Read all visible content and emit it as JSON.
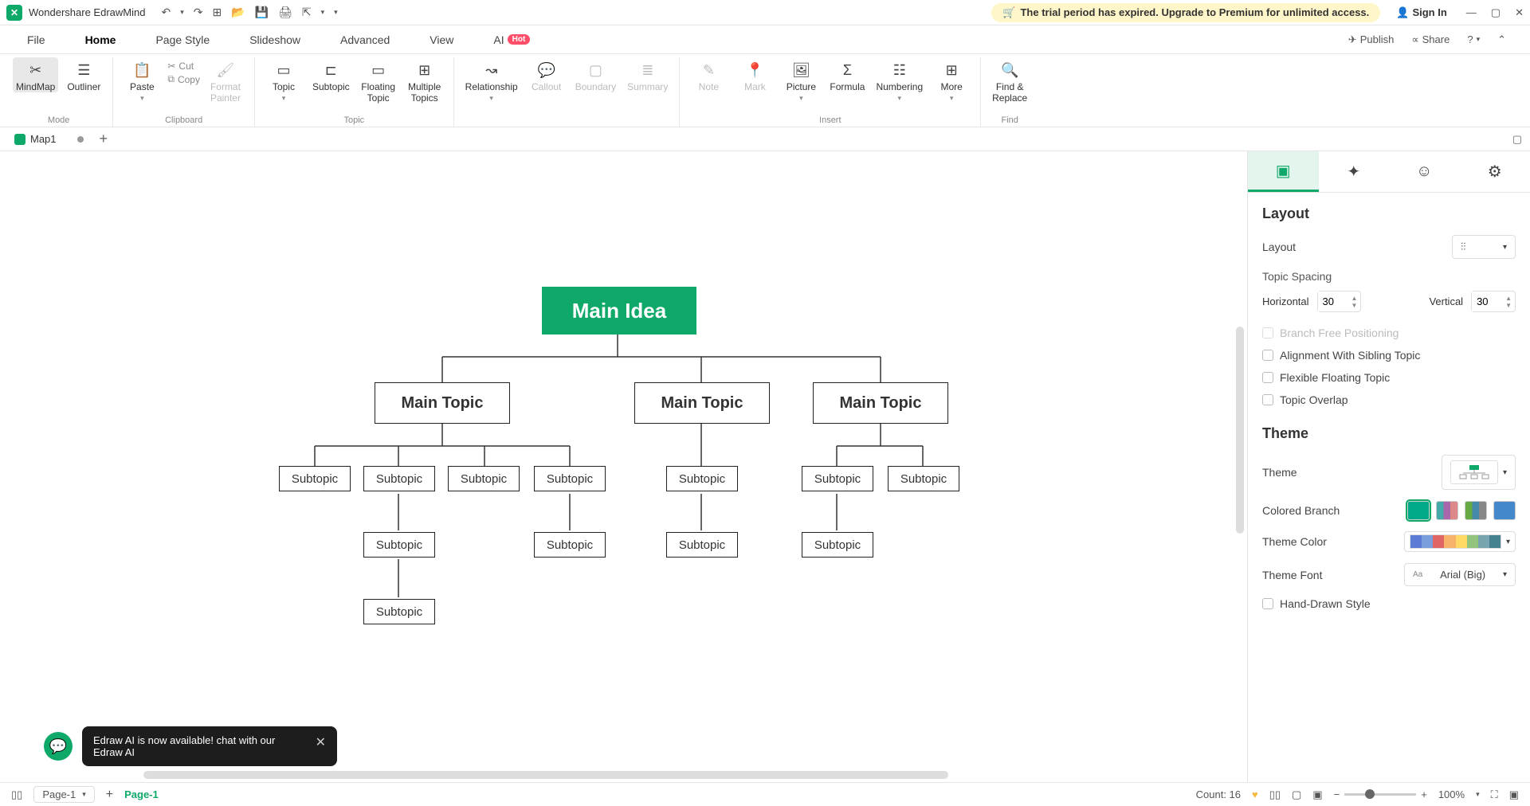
{
  "app": {
    "title": "Wondershare EdrawMind"
  },
  "trial": {
    "text": "The trial period has expired. Upgrade to Premium for unlimited access."
  },
  "signin": "Sign In",
  "menu": {
    "tabs": [
      "File",
      "Home",
      "Page Style",
      "Slideshow",
      "Advanced",
      "View",
      "AI"
    ],
    "hot": "Hot",
    "publish": "Publish",
    "share": "Share"
  },
  "ribbon": {
    "mode": {
      "mindmap": "MindMap",
      "outliner": "Outliner",
      "label": "Mode"
    },
    "clipboard": {
      "paste": "Paste",
      "cut": "Cut",
      "copy": "Copy",
      "format": "Format\nPainter",
      "label": "Clipboard"
    },
    "topic": {
      "topic": "Topic",
      "subtopic": "Subtopic",
      "floating": "Floating\nTopic",
      "multiple": "Multiple\nTopics",
      "label": "Topic"
    },
    "additions": {
      "relationship": "Relationship",
      "callout": "Callout",
      "boundary": "Boundary",
      "summary": "Summary"
    },
    "insert": {
      "note": "Note",
      "mark": "Mark",
      "picture": "Picture",
      "formula": "Formula",
      "numbering": "Numbering",
      "more": "More",
      "label": "Insert"
    },
    "find": {
      "findreplace": "Find &\nReplace",
      "label": "Find"
    }
  },
  "doctab": {
    "name": "Map1"
  },
  "mindmap": {
    "main_idea": "Main Idea",
    "main_topic": "Main Topic",
    "subtopic": "Subtopic"
  },
  "ai_bubble": {
    "text": "Edraw AI is now available!  chat with our Edraw AI"
  },
  "panel": {
    "layout_title": "Layout",
    "layout_label": "Layout",
    "topic_spacing": "Topic Spacing",
    "horizontal": "Horizontal",
    "vertical": "Vertical",
    "h_val": "30",
    "v_val": "30",
    "branch_free": "Branch Free Positioning",
    "align_sibling": "Alignment With Sibling Topic",
    "flex_floating": "Flexible Floating Topic",
    "topic_overlap": "Topic Overlap",
    "theme_title": "Theme",
    "theme_label": "Theme",
    "colored_branch": "Colored Branch",
    "theme_color": "Theme Color",
    "theme_font": "Theme Font",
    "font_value": "Arial (Big)",
    "hand_drawn": "Hand-Drawn Style"
  },
  "status": {
    "page_sel": "Page-1",
    "page_active": "Page-1",
    "count": "Count: 16",
    "zoom": "100%"
  }
}
